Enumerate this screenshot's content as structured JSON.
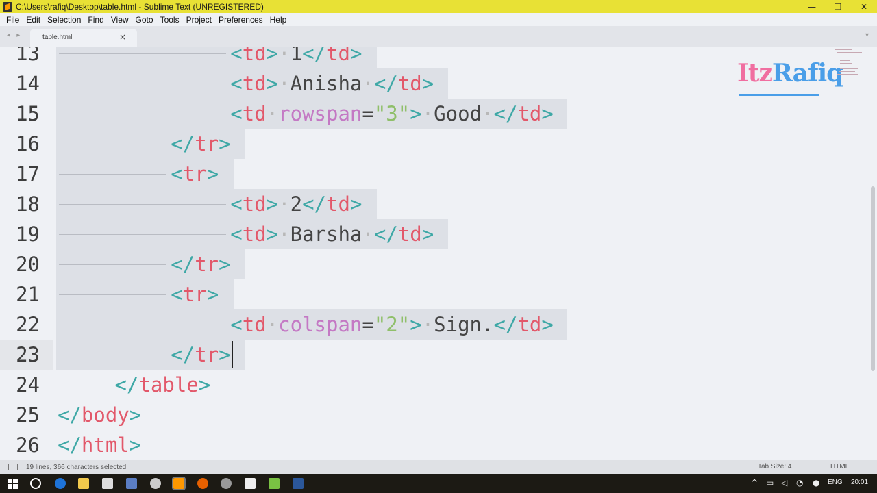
{
  "window": {
    "title": "C:\\Users\\rafiq\\Desktop\\table.html - Sublime Text (UNREGISTERED)",
    "minimize": "—",
    "maximize": "❐",
    "close": "✕"
  },
  "menu": [
    "File",
    "Edit",
    "Selection",
    "Find",
    "View",
    "Goto",
    "Tools",
    "Project",
    "Preferences",
    "Help"
  ],
  "tab": {
    "label": "table.html",
    "close": "×",
    "nav": "◂ ▸",
    "dropdown": "▾"
  },
  "lines": [
    {
      "num": "13",
      "text": "<td>·1</td>"
    },
    {
      "num": "14",
      "text": "<td>·Anisha·</td>"
    },
    {
      "num": "15",
      "text": "<td·rowspan=\"3\">·Good·</td>"
    },
    {
      "num": "16",
      "text": "</tr>"
    },
    {
      "num": "17",
      "text": "<tr>"
    },
    {
      "num": "18",
      "text": "<td>·2</td>"
    },
    {
      "num": "19",
      "text": "<td>·Barsha·</td>"
    },
    {
      "num": "20",
      "text": "</tr>"
    },
    {
      "num": "21",
      "text": "<tr>"
    },
    {
      "num": "22",
      "text": "<td·colspan=\"2\">·Sign.</td>"
    },
    {
      "num": "23",
      "text": "</tr>"
    },
    {
      "num": "24",
      "text": "</table>"
    },
    {
      "num": "25",
      "text": "</body>"
    },
    {
      "num": "26",
      "text": "</html>"
    }
  ],
  "watermark": {
    "part1": "Itz",
    "part2": "Rafiq"
  },
  "status": {
    "selection": "19 lines, 366 characters selected",
    "tab_size": "Tab Size: 4",
    "syntax": "HTML"
  },
  "taskbar": {
    "language": "ENG",
    "time": "20:01"
  }
}
